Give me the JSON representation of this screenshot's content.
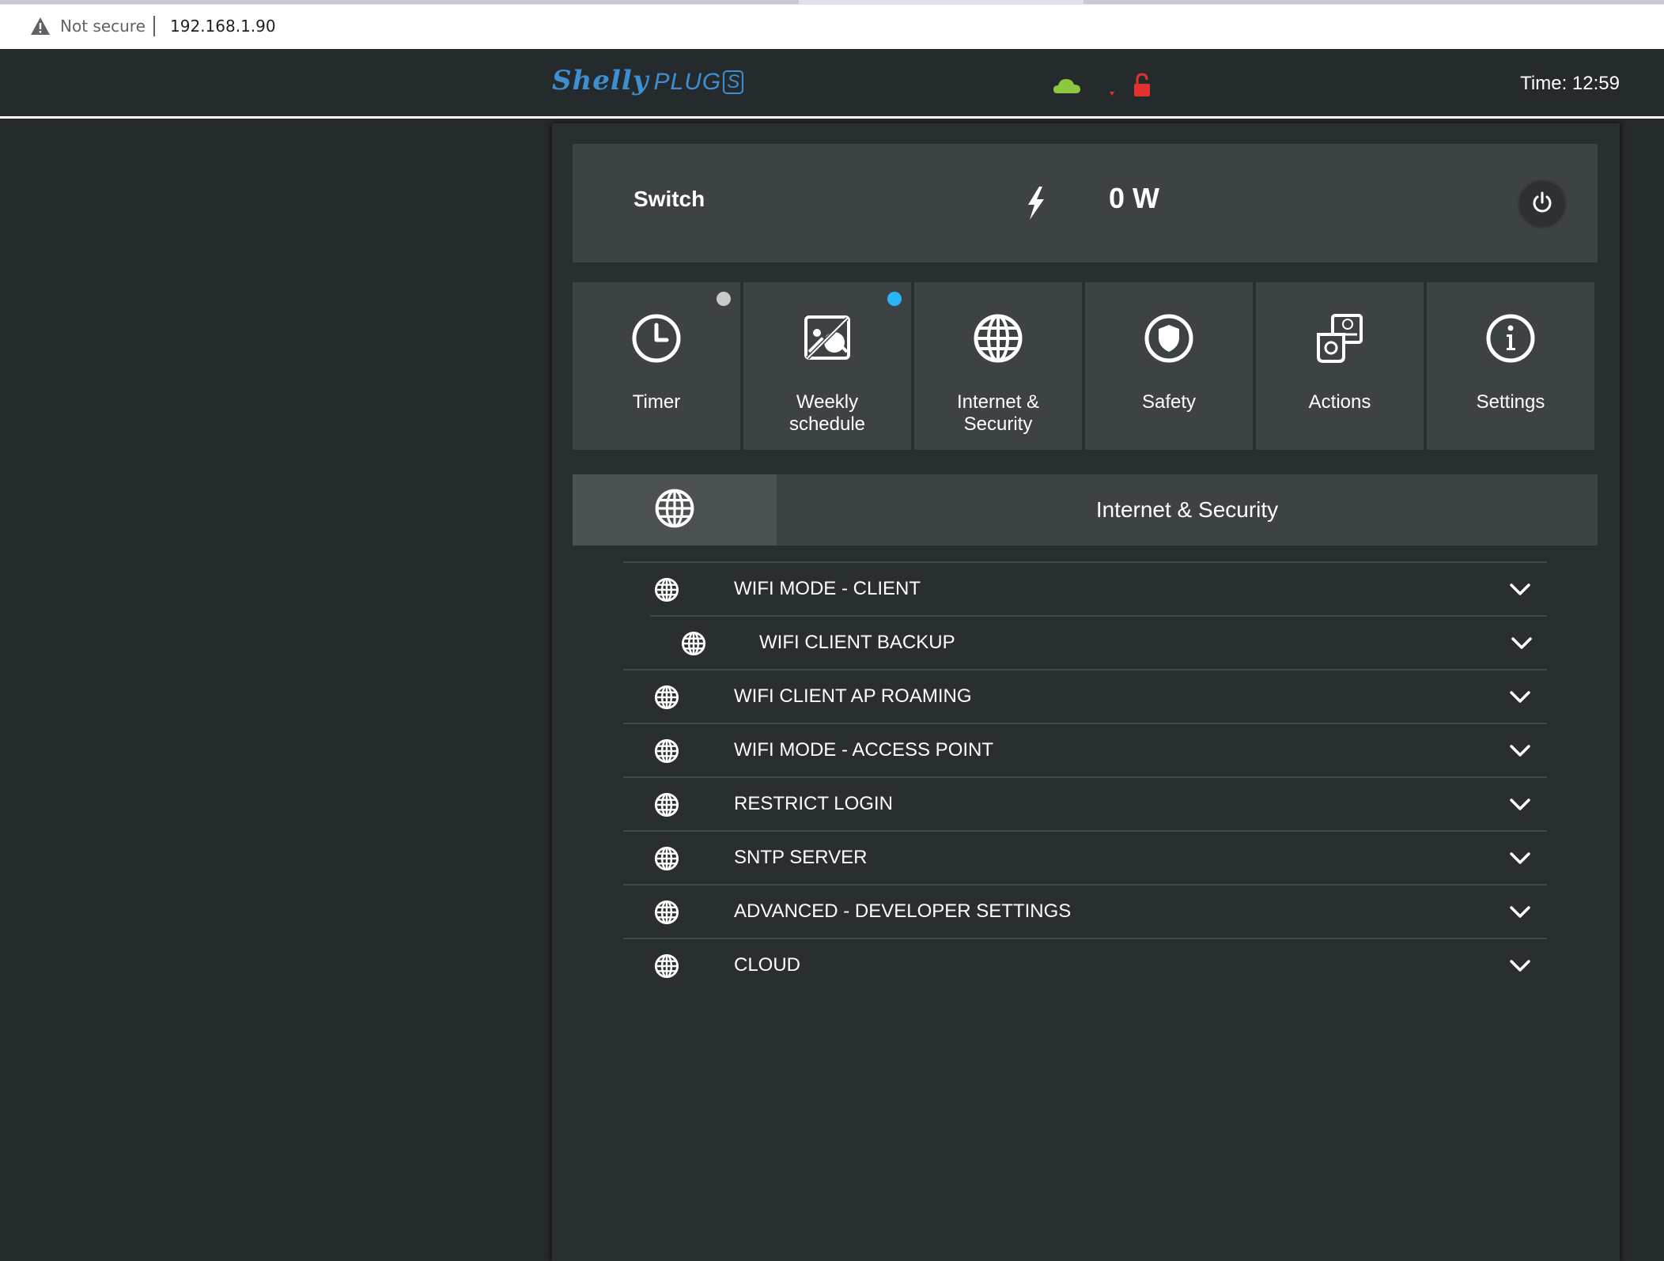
{
  "browser": {
    "security_label": "Not secure",
    "url": "192.168.1.90"
  },
  "header": {
    "logo_brand": "Shelly",
    "logo_product": "PLUG",
    "logo_badge": "S",
    "time": "Time: 12:59",
    "status_icons": [
      "cloud-icon",
      "wifi-signal-icon",
      "lock-open-icon"
    ],
    "colors": {
      "cloud": "#8dc63f",
      "lock": "#e0322e",
      "wifi": "#e0322e",
      "brand": "#3d8fd1"
    }
  },
  "switch": {
    "label": "Switch",
    "power": "0 W"
  },
  "tiles": [
    {
      "label": "Timer",
      "icon": "clock-icon",
      "indicator": "#c9c9c9"
    },
    {
      "label": "Weekly schedule",
      "icon": "calendar-schedule-icon",
      "indicator": "#29b6f6"
    },
    {
      "label": "Internet & Security",
      "icon": "globe-icon"
    },
    {
      "label": "Safety",
      "icon": "shield-icon"
    },
    {
      "label": "Actions",
      "icon": "actions-icon"
    },
    {
      "label": "Settings",
      "icon": "info-icon"
    }
  ],
  "section": {
    "title": "Internet & Security"
  },
  "settings": [
    {
      "label": "WIFI MODE - CLIENT"
    },
    {
      "label": "WIFI CLIENT BACKUP"
    },
    {
      "label": "WIFI CLIENT AP ROAMING"
    },
    {
      "label": "WIFI MODE - ACCESS POINT"
    },
    {
      "label": "RESTRICT LOGIN"
    },
    {
      "label": "SNTP SERVER"
    },
    {
      "label": "ADVANCED - DEVELOPER SETTINGS"
    },
    {
      "label": "CLOUD"
    }
  ]
}
